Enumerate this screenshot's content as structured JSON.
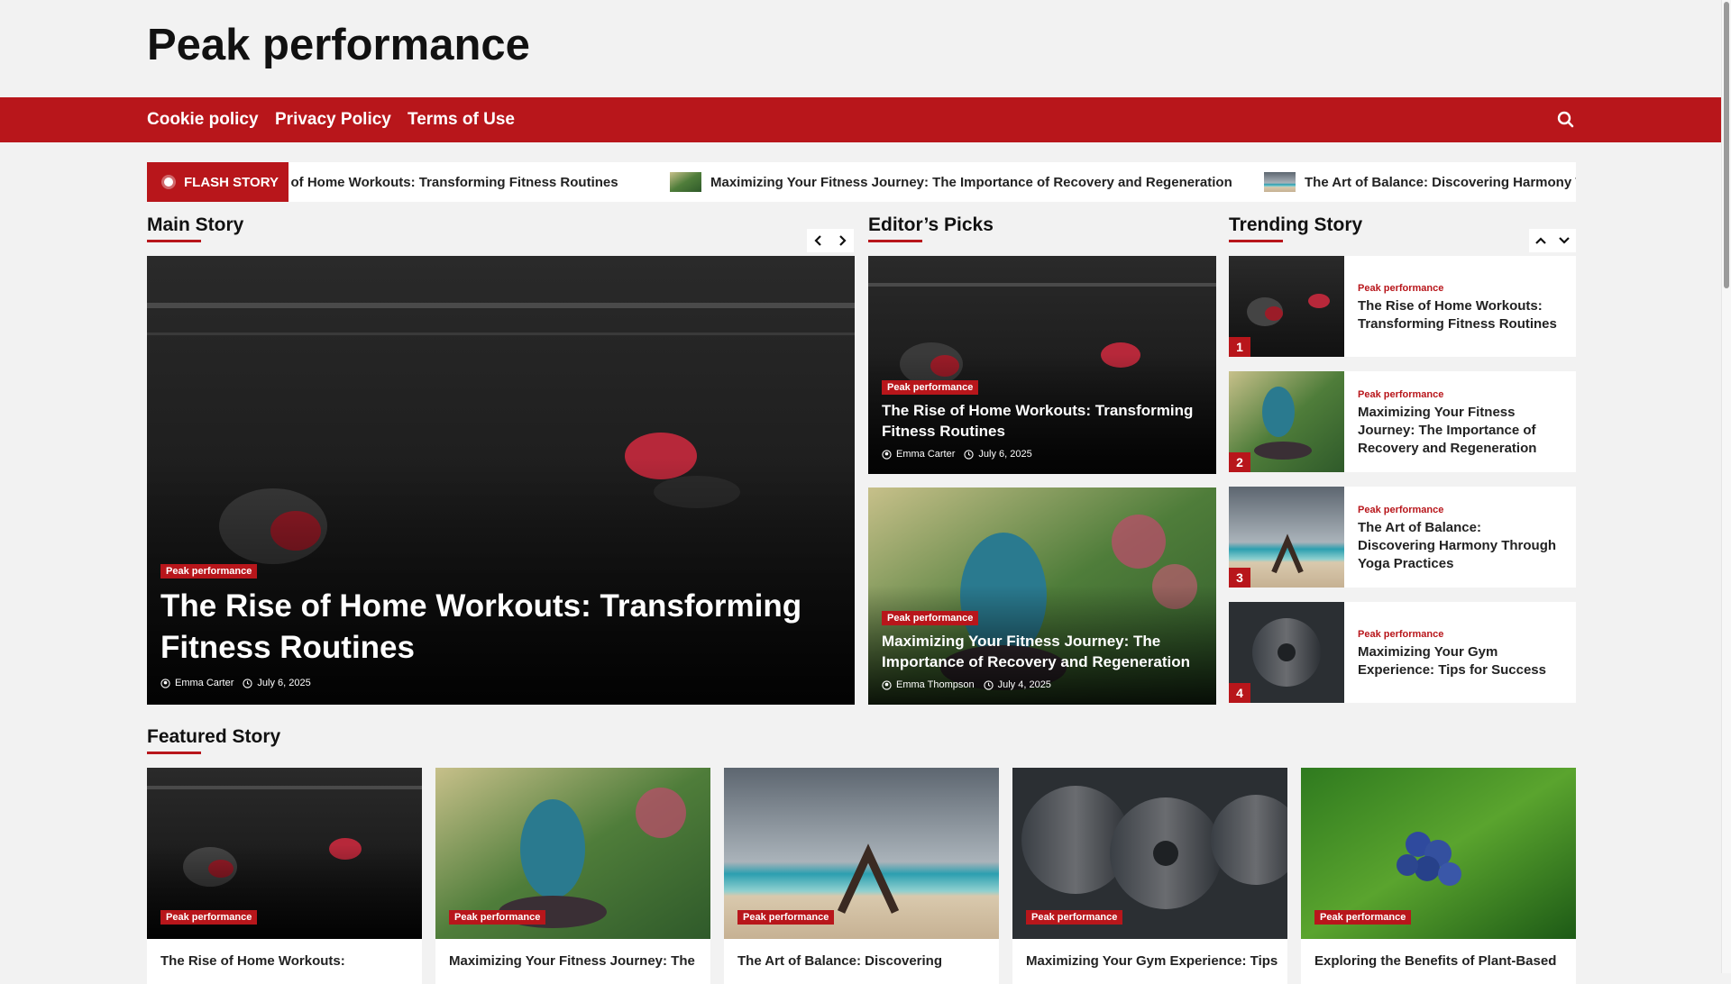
{
  "site": {
    "title": "Peak performance"
  },
  "nav": {
    "links": [
      "Cookie policy",
      "Privacy Policy",
      "Terms of Use"
    ],
    "search_icon": "search-icon"
  },
  "ticker": {
    "label": "FLASH STORY",
    "items": [
      "e of Home Workouts: Transforming Fitness Routines",
      "Maximizing Your Fitness Journey: The Importance of Recovery and Regeneration",
      "The Art of Balance: Discovering Harmony Th"
    ]
  },
  "main_story": {
    "heading": "Main Story",
    "category": "Peak performance",
    "title": "The Rise of Home Workouts: Transforming Fitness Routines",
    "author": "Emma Carter",
    "date": "July 6, 2025",
    "prev_icon": "chevron-left-icon",
    "next_icon": "chevron-right-icon"
  },
  "editors_picks": {
    "heading": "Editor’s Picks",
    "items": [
      {
        "category": "Peak performance",
        "title": "The Rise of Home Workouts: Transforming Fitness Routines",
        "author": "Emma Carter",
        "date": "July 6, 2025"
      },
      {
        "category": "Peak performance",
        "title": "Maximizing Your Fitness Journey: The Importance of Recovery and Regeneration",
        "author": "Emma Thompson",
        "date": "July 4, 2025"
      }
    ]
  },
  "trending": {
    "heading": "Trending Story",
    "up_icon": "chevron-up-icon",
    "down_icon": "chevron-down-icon",
    "items": [
      {
        "num": "1",
        "category": "Peak performance",
        "title": "The Rise of Home Workouts: Transforming Fitness Routines"
      },
      {
        "num": "2",
        "category": "Peak performance",
        "title": "Maximizing Your Fitness Journey: The Importance of Recovery and Regeneration"
      },
      {
        "num": "3",
        "category": "Peak performance",
        "title": "The Art of Balance: Discovering Harmony Through Yoga Practices"
      },
      {
        "num": "4",
        "category": "Peak performance",
        "title": "Maximizing Your Gym Experience: Tips for Success"
      }
    ]
  },
  "featured": {
    "heading": "Featured Story",
    "items": [
      {
        "category": "Peak performance",
        "title": "The Rise of Home Workouts:"
      },
      {
        "category": "Peak performance",
        "title": "Maximizing Your Fitness Journey: The"
      },
      {
        "category": "Peak performance",
        "title": "The Art of Balance: Discovering"
      },
      {
        "category": "Peak performance",
        "title": "Maximizing Your Gym Experience: Tips"
      },
      {
        "category": "Peak performance",
        "title": "Exploring the Benefits of Plant-Based"
      }
    ]
  },
  "colors": {
    "accent": "#b8161b",
    "background": "#f2f2f2"
  }
}
